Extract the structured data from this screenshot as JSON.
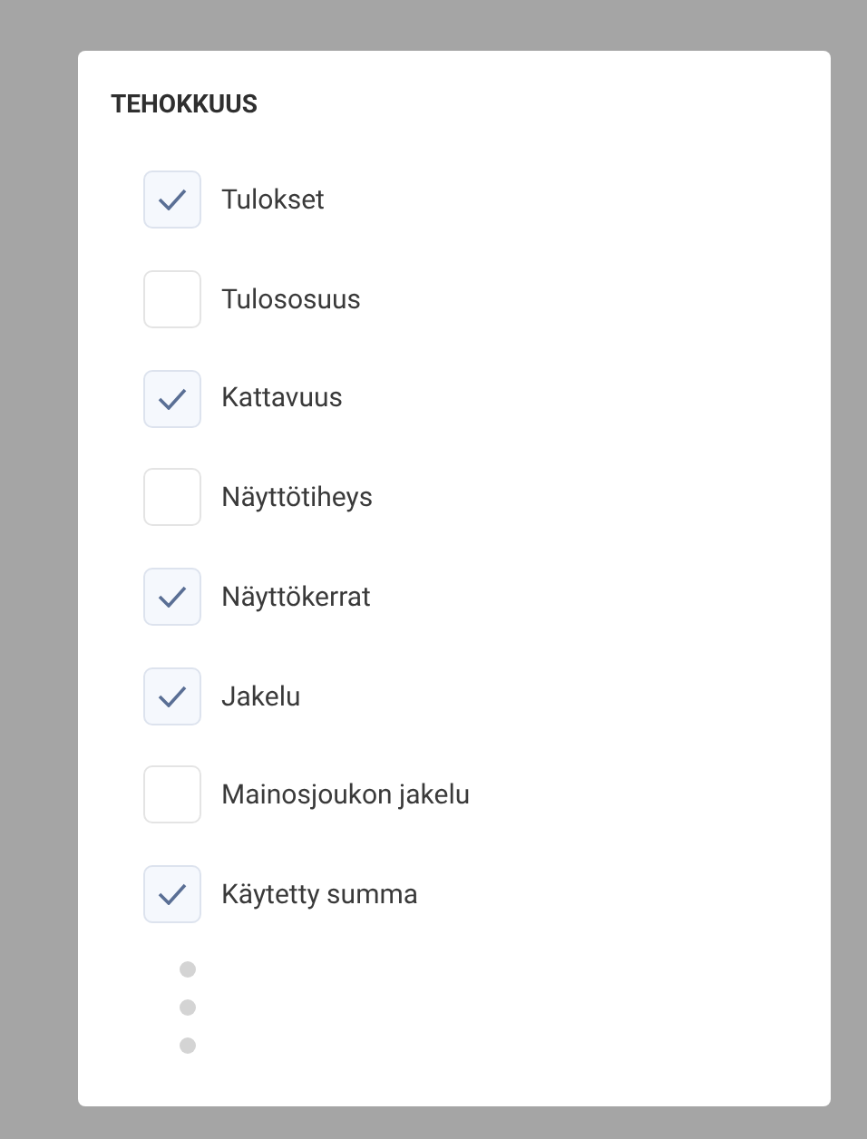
{
  "section": {
    "title": "TEHOKKUUS",
    "options": [
      {
        "label": "Tulokset",
        "checked": true
      },
      {
        "label": "Tulososuus",
        "checked": false
      },
      {
        "label": "Kattavuus",
        "checked": true
      },
      {
        "label": "Näyttötiheys",
        "checked": false
      },
      {
        "label": "Näyttökerrat",
        "checked": true
      },
      {
        "label": "Jakelu",
        "checked": true
      },
      {
        "label": "Mainosjoukon jakelu",
        "checked": false
      },
      {
        "label": "Käytetty summa",
        "checked": true
      }
    ]
  }
}
